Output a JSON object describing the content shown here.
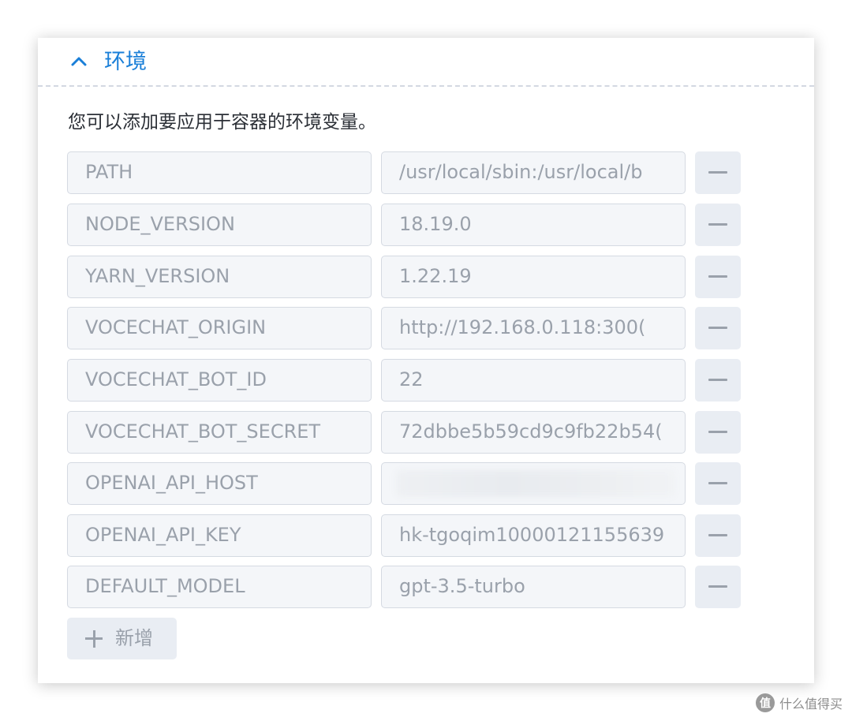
{
  "section": {
    "title": "环境",
    "description": "您可以添加要应用于容器的环境变量。"
  },
  "env": [
    {
      "name": "PATH",
      "value": "/usr/local/sbin:/usr/local/b"
    },
    {
      "name": "NODE_VERSION",
      "value": "18.19.0"
    },
    {
      "name": "YARN_VERSION",
      "value": "1.22.19"
    },
    {
      "name": "VOCECHAT_ORIGIN",
      "value": "http://192.168.0.118:300("
    },
    {
      "name": "VOCECHAT_BOT_ID",
      "value": "22"
    },
    {
      "name": "VOCECHAT_BOT_SECRET",
      "value": "72dbbe5b59cd9c9fb22b54("
    },
    {
      "name": "OPENAI_API_HOST",
      "value": ""
    },
    {
      "name": "OPENAI_API_KEY",
      "value": "hk-tgoqim10000121155639"
    },
    {
      "name": "DEFAULT_MODEL",
      "value": "gpt-3.5-turbo"
    }
  ],
  "add_button": {
    "label": "新增"
  },
  "watermark": {
    "text": "什么值得买",
    "icon_label": "值"
  },
  "icons": {
    "collapse": "chevron-up-icon",
    "remove": "minus-icon",
    "add": "plus-icon"
  },
  "colors": {
    "accent": "#1a7fd8",
    "field_bg": "#f4f6f9",
    "button_bg": "#e9edf3",
    "muted_text": "#9aa1ab"
  }
}
